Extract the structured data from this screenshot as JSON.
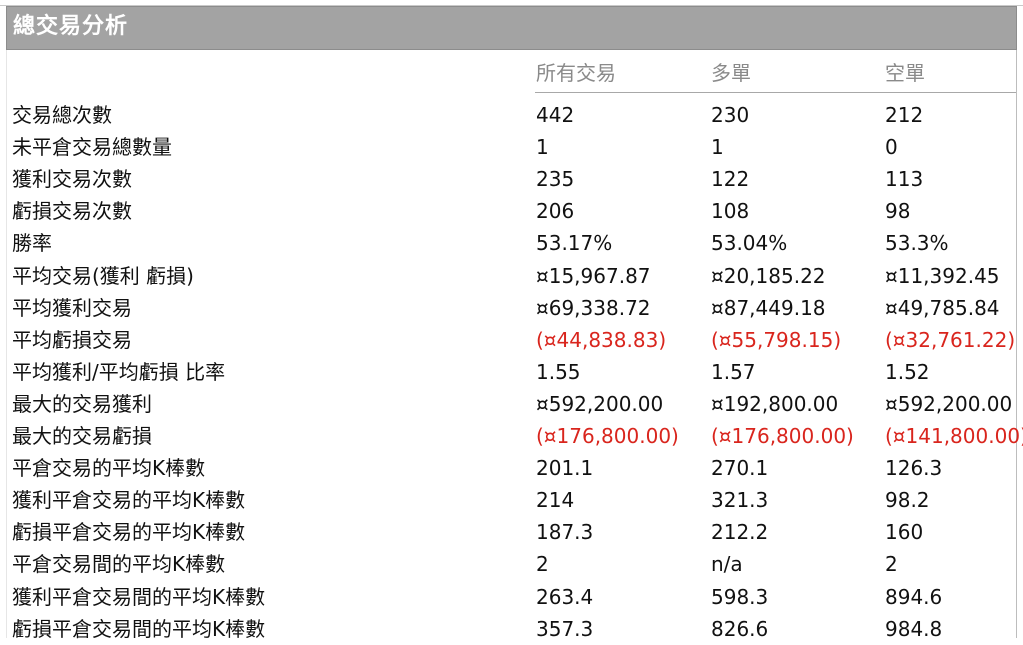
{
  "panel": {
    "title": "總交易分析",
    "columns": [
      "所有交易",
      "多單",
      "空單"
    ]
  },
  "rows": [
    {
      "label": "交易總次數",
      "all": "442",
      "long": "230",
      "short": "212",
      "negative": false
    },
    {
      "label": "未平倉交易總數量",
      "all": "1",
      "long": "1",
      "short": "0",
      "negative": false
    },
    {
      "label": "獲利交易次數",
      "all": "235",
      "long": "122",
      "short": "113",
      "negative": false
    },
    {
      "label": "虧損交易次數",
      "all": "206",
      "long": "108",
      "short": "98",
      "negative": false
    },
    {
      "label": "勝率",
      "all": "53.17%",
      "long": "53.04%",
      "short": "53.3%",
      "negative": false
    },
    {
      "label": "平均交易(獲利  虧損)",
      "all": "¤15,967.87",
      "long": "¤20,185.22",
      "short": "¤11,392.45",
      "negative": false
    },
    {
      "label": "平均獲利交易",
      "all": "¤69,338.72",
      "long": "¤87,449.18",
      "short": "¤49,785.84",
      "negative": false
    },
    {
      "label": "平均虧損交易",
      "all": "(¤44,838.83)",
      "long": "(¤55,798.15)",
      "short": "(¤32,761.22)",
      "negative": true
    },
    {
      "label": "平均獲利/平均虧損  比率",
      "all": "1.55",
      "long": "1.57",
      "short": "1.52",
      "negative": false
    },
    {
      "label": "最大的交易獲利",
      "all": "¤592,200.00",
      "long": "¤192,800.00",
      "short": "¤592,200.00",
      "negative": false
    },
    {
      "label": "最大的交易虧損",
      "all": "(¤176,800.00)",
      "long": "(¤176,800.00)",
      "short": "(¤141,800.00)",
      "negative": true
    },
    {
      "label": "平倉交易的平均K棒數",
      "all": "201.1",
      "long": "270.1",
      "short": "126.3",
      "negative": false
    },
    {
      "label": "獲利平倉交易的平均K棒數",
      "all": "214",
      "long": "321.3",
      "short": "98.2",
      "negative": false
    },
    {
      "label": "虧損平倉交易的平均K棒數",
      "all": "187.3",
      "long": "212.2",
      "short": "160",
      "negative": false
    },
    {
      "label": "平倉交易間的平均K棒數",
      "all": "2",
      "long": "n/a",
      "short": "2",
      "negative": false
    },
    {
      "label": "獲利平倉交易間的平均K棒數",
      "all": "263.4",
      "long": "598.3",
      "short": "894.6",
      "negative": false
    },
    {
      "label": "虧損平倉交易間的平均K棒數",
      "all": "357.3",
      "long": "826.6",
      "short": "984.8",
      "negative": false
    }
  ],
  "colors": {
    "title_bar": "#a3a3a3",
    "negative": "#d9251d",
    "header_text": "#8a8a8a"
  }
}
